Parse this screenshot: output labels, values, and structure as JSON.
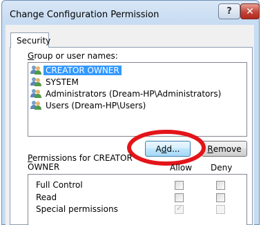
{
  "window": {
    "title": "Change Configuration Permission",
    "help_label": "?",
    "close_label": "✕"
  },
  "tabs": [
    {
      "label": "Security"
    }
  ],
  "groups": {
    "label_prefix": "",
    "label_underlined": "G",
    "label_rest": "roup or user names:",
    "items": [
      {
        "name": "CREATOR OWNER",
        "selected": true,
        "icon": "users-icon"
      },
      {
        "name": "SYSTEM",
        "selected": false,
        "icon": "users-icon"
      },
      {
        "name": "Administrators (Dream-HP\\Administrators)",
        "selected": false,
        "icon": "users-icon"
      },
      {
        "name": "Users (Dream-HP\\Users)",
        "selected": false,
        "icon": "users-icon"
      }
    ]
  },
  "buttons": {
    "add_pre": "A",
    "add_u": "d",
    "add_post": "d...",
    "remove_u": "R",
    "remove_post": "emove"
  },
  "highlight_color": "#e3151a",
  "permissions": {
    "label_pre": "",
    "label_u": "P",
    "label_line1": "ermissions for CREATOR",
    "label_line2": "OWNER",
    "allow_header": "Allow",
    "deny_header": "Deny",
    "rows": [
      {
        "name": "Full Control",
        "allow": false,
        "deny": false
      },
      {
        "name": "Read",
        "allow": false,
        "deny": false
      },
      {
        "name": "Special permissions",
        "allow": true,
        "deny": false
      }
    ]
  }
}
